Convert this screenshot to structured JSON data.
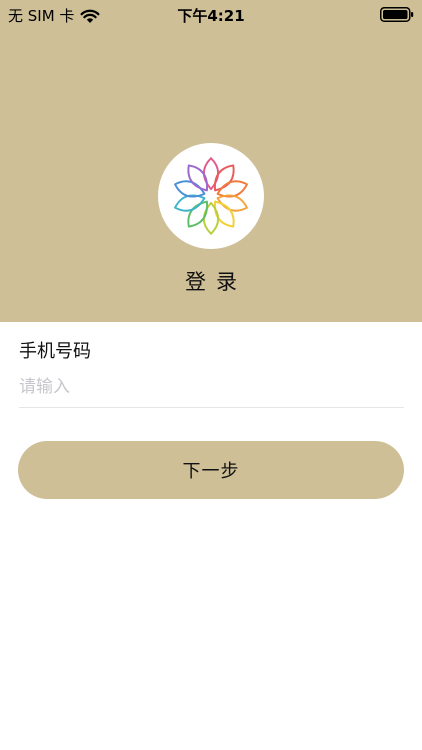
{
  "status_bar": {
    "carrier": "无 SIM 卡",
    "time": "下午4:21",
    "wifi_icon": "wifi-icon",
    "battery_icon": "battery-icon"
  },
  "header": {
    "background_color": "#cebf97",
    "logo_icon": "lotus-flower-logo-icon",
    "title": "登录"
  },
  "form": {
    "phone_label": "手机号码",
    "phone_value": "",
    "phone_placeholder": "请输入"
  },
  "actions": {
    "next_label": "下一步",
    "button_color": "#cebf97"
  }
}
